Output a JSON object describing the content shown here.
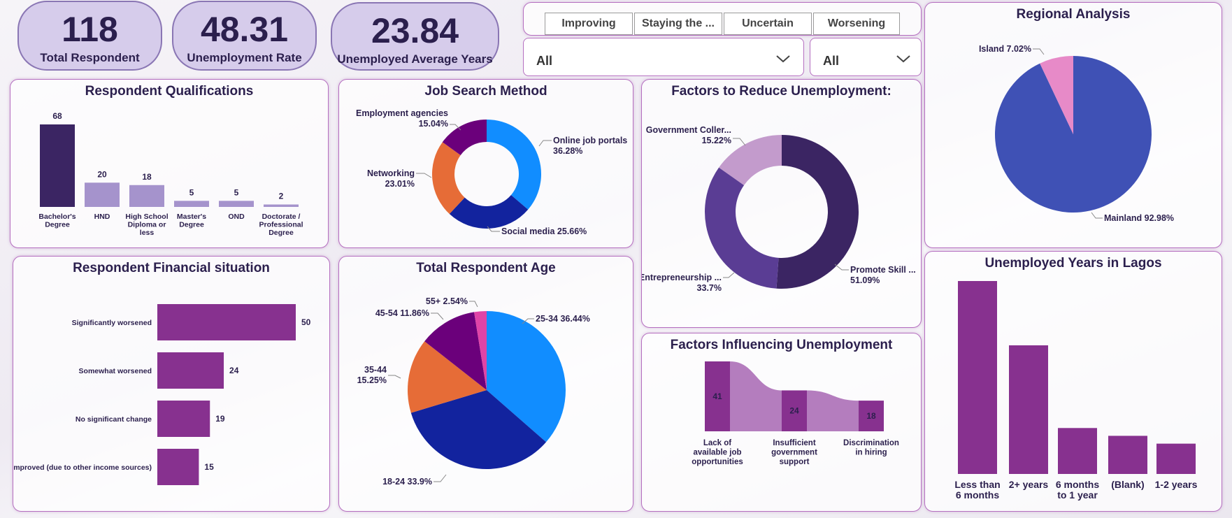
{
  "kpis": [
    {
      "value": "118",
      "label": "Total Respondent"
    },
    {
      "value": "48.31",
      "label": "Unemployment Rate"
    },
    {
      "value": "23.84",
      "label": "Unemployed Average Years"
    }
  ],
  "slicer": {
    "buttons": [
      "Improving",
      "Staying the ...",
      "Uncertain",
      "Worsening"
    ],
    "dropdown1": "All",
    "dropdown2": "All"
  },
  "colors": {
    "dark_purple": "#3b2563",
    "light_purple": "#a593cc",
    "magenta_bar": "#87318f",
    "pie_blue": "#3f51b5",
    "pie_pink": "#e78ac8"
  },
  "chart_data": [
    {
      "id": "qualifications",
      "type": "bar",
      "title": "Respondent Qualifications",
      "categories": [
        "Bachelor's Degree",
        "HND",
        "High School Diploma or less",
        "Master's Degree",
        "OND",
        "Doctorate / Professional Degree"
      ],
      "category_lines": [
        [
          "Bachelor's",
          "Degree"
        ],
        [
          "HND"
        ],
        [
          "High School",
          "Diploma or",
          "less"
        ],
        [
          "Master's",
          "Degree"
        ],
        [
          "OND"
        ],
        [
          "Doctorate /",
          "Professional",
          "Degree"
        ]
      ],
      "values": [
        68,
        20,
        18,
        5,
        5,
        2
      ],
      "value_labels": [
        "68",
        "20",
        "18",
        "5",
        "5",
        "2"
      ]
    },
    {
      "id": "job_search",
      "type": "pie",
      "donut": true,
      "title": "Job Search Method",
      "slices": [
        {
          "label": "Online job portals",
          "pct_label": "36.28%",
          "value": 36.28,
          "color": "#118dff"
        },
        {
          "label": "Social media",
          "pct_label": "25.66%",
          "value": 25.66,
          "color": "#12239e"
        },
        {
          "label": "Networking",
          "pct_label": "23.01%",
          "value": 23.01,
          "color": "#e66c37"
        },
        {
          "label": "Employment agencies",
          "pct_label": "15.04%",
          "value": 15.04,
          "color": "#6b007b"
        }
      ]
    },
    {
      "id": "reduce_factors",
      "type": "pie",
      "donut": true,
      "title": "Factors to Reduce Unemployment:",
      "slices": [
        {
          "label": "Promote Skill ...",
          "pct_label": "51.09%",
          "value": 51.09,
          "color": "#3b2563"
        },
        {
          "label": "Entrepreneurship ...",
          "pct_label": "33.7%",
          "value": 33.7,
          "color": "#5a3d94"
        },
        {
          "label": "Government Coller...",
          "pct_label": "15.22%",
          "value": 15.22,
          "color": "#c39bcc"
        }
      ]
    },
    {
      "id": "regional",
      "type": "pie",
      "title": "Regional Analysis",
      "slices": [
        {
          "label": "Mainland 92.98%",
          "value": 92.98,
          "color": "#3f51b5"
        },
        {
          "label": "Island 7.02%",
          "value": 7.02,
          "color": "#e78ac8"
        }
      ]
    },
    {
      "id": "financial",
      "type": "bar",
      "orientation": "horizontal",
      "title": "Respondent Financial situation",
      "categories": [
        "Significantly worsened",
        "Somewhat worsened",
        "No significant change",
        "Improved (due to other income sources)"
      ],
      "values": [
        50,
        24,
        19,
        15
      ],
      "value_labels": [
        "50",
        "24",
        "19",
        "15"
      ]
    },
    {
      "id": "age",
      "type": "pie",
      "title": "Total Respondent Age",
      "slices": [
        {
          "label": "25-34",
          "pct_label": "36.44%",
          "value": 36.44,
          "color": "#118dff"
        },
        {
          "label": "18-24",
          "pct_label": "33.9%",
          "value": 33.9,
          "color": "#12239e"
        },
        {
          "label": "35-44",
          "pct_label": "15.25%",
          "value": 15.25,
          "color": "#e66c37"
        },
        {
          "label": "45-54",
          "pct_label": "11.86%",
          "value": 11.86,
          "color": "#6b007b"
        },
        {
          "label": "55+",
          "pct_label": "2.54%",
          "value": 2.54,
          "color": "#e044a7"
        }
      ]
    },
    {
      "id": "influencing",
      "type": "bar",
      "subtype": "ribbon",
      "title": "Factors Influencing Unemployment",
      "categories": [
        "Lack of available job opportunities",
        "Insufficient government support",
        "Discrimination in hiring"
      ],
      "category_lines": [
        [
          "Lack of",
          "available job",
          "opportunities"
        ],
        [
          "Insufficient",
          "government",
          "support"
        ],
        [
          "Discrimination",
          "in hiring"
        ]
      ],
      "values": [
        41,
        24,
        18
      ],
      "value_labels": [
        "41",
        "24",
        "18"
      ]
    },
    {
      "id": "unemployed_years",
      "type": "bar",
      "title": "Unemployed Years in Lagos",
      "categories": [
        "Less than 6 months",
        "2+ years",
        "6 months to 1 year",
        "(Blank)",
        "1-2 years"
      ],
      "category_lines": [
        [
          "Less than",
          "6 months"
        ],
        [
          "2+ years"
        ],
        [
          "6 months",
          "to 1 year"
        ],
        [
          "(Blank)"
        ],
        [
          "1-2 years"
        ]
      ],
      "values": [
        42,
        28,
        10,
        8.3,
        6.6
      ]
    }
  ]
}
